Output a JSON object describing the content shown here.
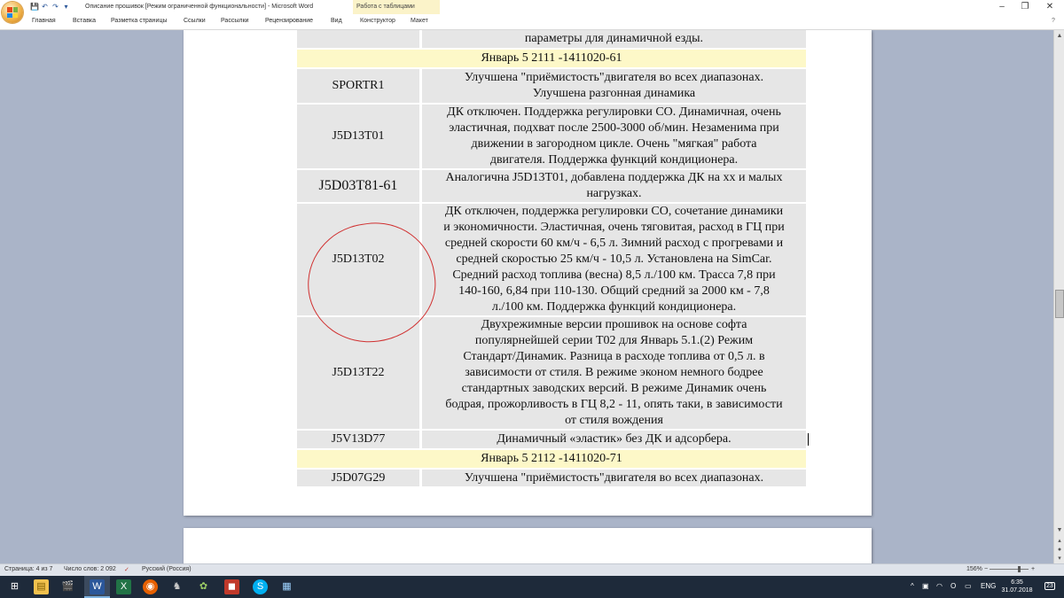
{
  "window": {
    "title": "Описание прошивок [Режим ограниченной функциональности] - Microsoft Word",
    "context_group": "Работа с таблицами",
    "minimize": "–",
    "restore": "❐",
    "close": "✕"
  },
  "quick_access": [
    "💾",
    "↶",
    "↷",
    "▾"
  ],
  "ribbon_tabs": [
    "Главная",
    "Вставка",
    "Разметка страницы",
    "Ссылки",
    "Рассылки",
    "Рецензирование",
    "Вид",
    "Конструктор",
    "Макет"
  ],
  "ribbon_extra": "?",
  "table": {
    "top_fragment": "параметры для динамичной езды.",
    "section1": "Январь 5 2111 -1411020-61",
    "rows": [
      {
        "code": "SPORTR1",
        "desc": "Улучшена \"приёмистость\"двигателя во всех диапазонах.\nУлучшена разгонная динамика"
      },
      {
        "code": "J5D13T01",
        "desc": "ДК отключен. Поддержка регулировки СО. Динамичная, очень\nэластичная, подхват после 2500-3000 об/мин. Незаменима при\nдвижении в загородном цикле. Очень \"мягкая\" работа\nдвигателя. Поддержка функций кондиционера."
      },
      {
        "code": "J5D03T81-61",
        "desc": "Аналогична J5D13T01, добавлена поддержка ДК на хх и малых\nнагрузках."
      },
      {
        "code": "J5D13T02",
        "desc": "ДК отключен, поддержка регулировки СО, сочетание динамики\nи экономичности. Эластичная, очень тяговитая, расход в ГЦ при\nсредней скорости 60 км/ч - 6,5 л. Зимний расход с прогревами и\nсредней скоростью 25 км/ч - 10,5 л. Установлена на SimCar.\nСредний расход топлива (весна) 8,5 л./100 км. Трасса 7,8 при\n140-160, 6,84 при 110-130. Общий средний за 2000 км - 7,8\nл./100 км. Поддержка функций кондиционера."
      },
      {
        "code": "J5D13T22",
        "desc": "Двухрежимные версии прошивок на основе софта\nпопулярнейшей серии T02 для Январь 5.1.(2) Режим\nСтандарт/Динамик. Разница в расходе топлива от 0,5 л. в\nзависимости от стиля. В режиме эконом немного бодрее\nстандартных заводских версий. В режиме Динамик очень\nбодрая, прожорливость в ГЦ 8,2 - 11, опять таки, в зависимости\nот стиля вождения"
      },
      {
        "code": "J5V13D77",
        "desc": "Динамичный «эластик» без ДК и адсорбера."
      }
    ],
    "section2": "Январь 5 2112 -1411020-71",
    "last_row": {
      "code": "J5D07G29",
      "desc": "Улучшена \"приёмистость\"двигателя во всех диапазонах."
    }
  },
  "status": {
    "page": "Страница: 4 из 7",
    "words": "Число слов: 2 092",
    "language": "Русский (Россия)",
    "zoom": "156%",
    "zoom_minus": "−",
    "zoom_plus": "+"
  },
  "tray": {
    "language": "ENG",
    "time": "6:35",
    "date": "31.07.2018",
    "notifications": "23"
  }
}
